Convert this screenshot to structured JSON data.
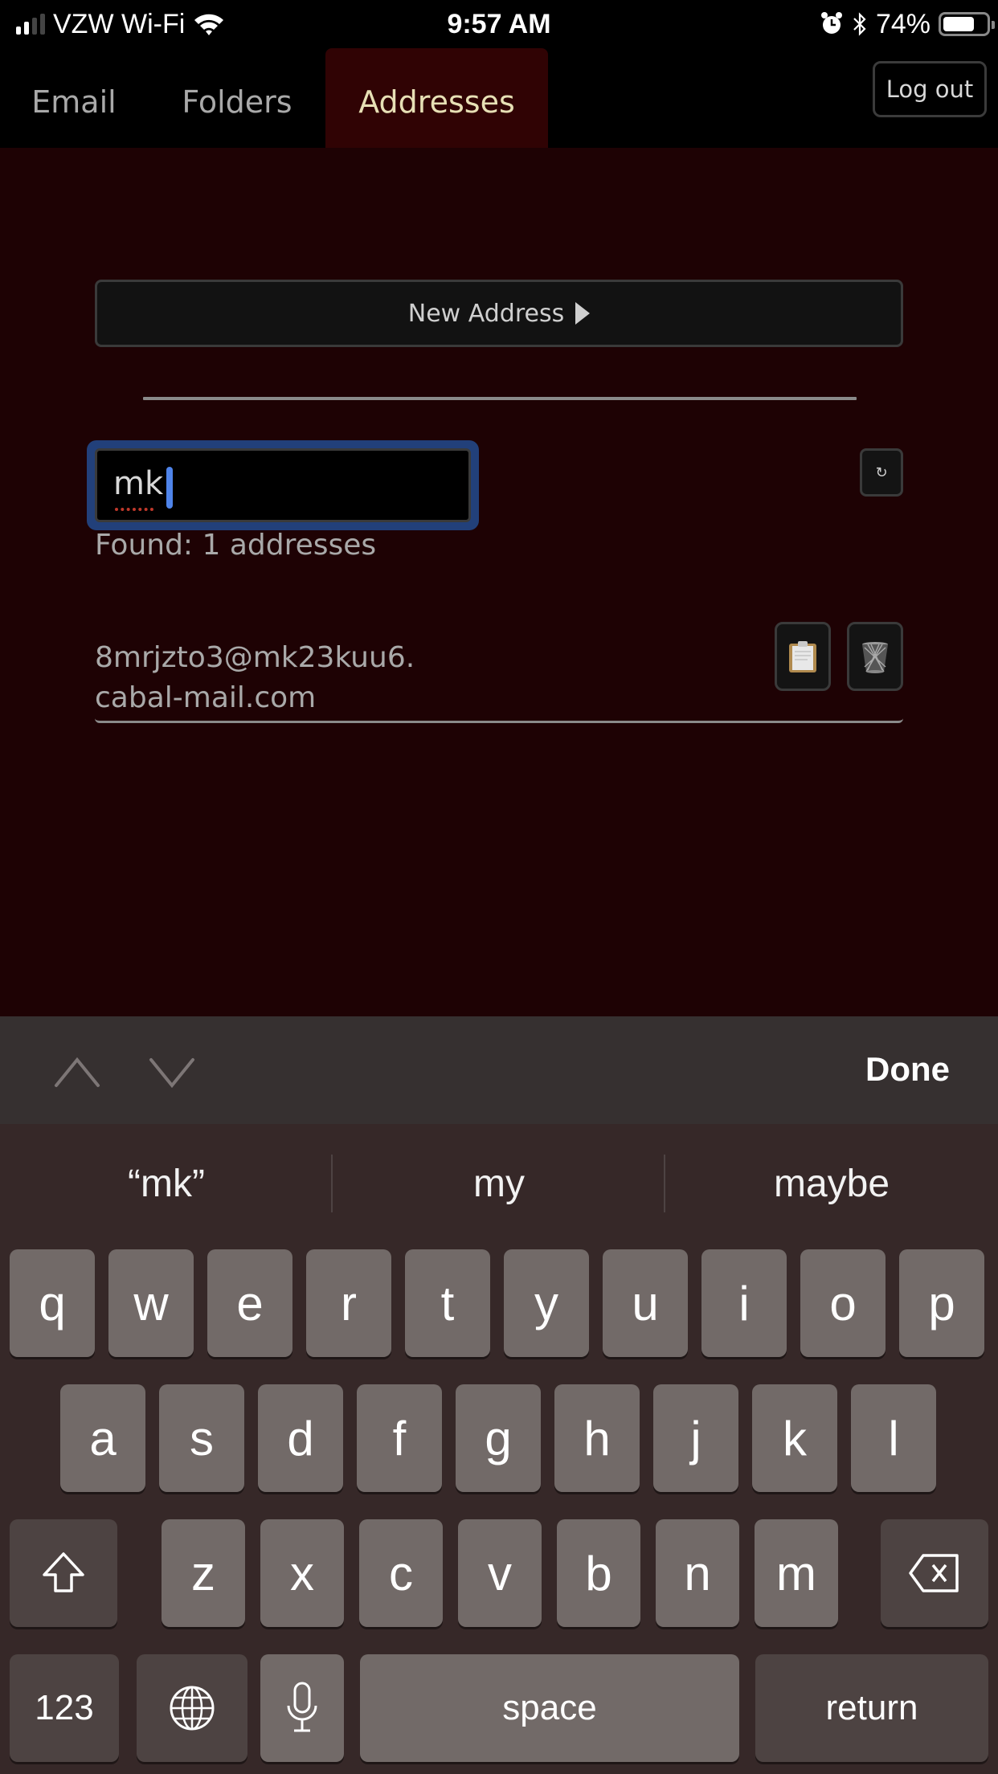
{
  "status_bar": {
    "carrier": "VZW Wi-Fi",
    "time": "9:57 AM",
    "battery_percent": "74%",
    "battery_level": 0.74,
    "signal_bars_active": 2,
    "signal_bars_total": 4,
    "icons": [
      "signal-icon",
      "wifi-icon",
      "alarm-icon",
      "bluetooth-icon",
      "battery-icon"
    ]
  },
  "nav": {
    "tabs": [
      {
        "label": "Email",
        "active": false
      },
      {
        "label": "Folders",
        "active": false
      },
      {
        "label": "Addresses",
        "active": true
      }
    ],
    "logout_label": "Log out"
  },
  "addresses": {
    "new_address_label": "New Address",
    "filter_value": "mk",
    "found_text": "Found: 1 addresses",
    "refresh_icon": "↻",
    "list": [
      {
        "address_line1": "8mrjzto3@mk23kuu6.",
        "address_line2": "cabal-mail.com",
        "actions": [
          "clipboard-icon",
          "trash-icon"
        ]
      }
    ]
  },
  "keyboard": {
    "done_label": "Done",
    "suggestions": [
      "“mk”",
      "my",
      "maybe"
    ],
    "rows": [
      [
        "q",
        "w",
        "e",
        "r",
        "t",
        "y",
        "u",
        "i",
        "o",
        "p"
      ],
      [
        "a",
        "s",
        "d",
        "f",
        "g",
        "h",
        "j",
        "k",
        "l"
      ],
      [
        "z",
        "x",
        "c",
        "v",
        "b",
        "n",
        "m"
      ]
    ],
    "numbers_label": "123",
    "space_label": "space",
    "return_label": "return"
  },
  "colors": {
    "page_bg": "#1e0204",
    "active_tab_bg": "#300304",
    "active_tab_text": "#e7e0b5",
    "focus_ring": "#22407a",
    "caret": "#4f84ea"
  }
}
